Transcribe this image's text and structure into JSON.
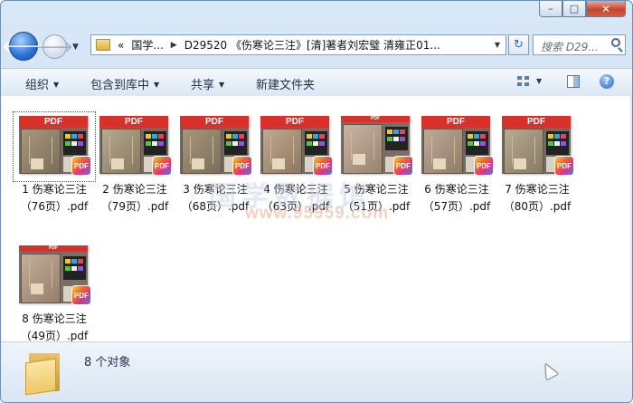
{
  "window": {
    "minimize_label": "–",
    "maximize_label": "□",
    "close_label": "✕"
  },
  "nav": {
    "back_label": "🡐",
    "forward_label": "🡒",
    "dropdown_label": "▼",
    "breadcrumb_overflow": "«",
    "breadcrumb_root": "国学...",
    "breadcrumb_sep": "▶",
    "breadcrumb_current": "D29520 《伤寒论三注》[清]著者刘宏璧 清雍正01...",
    "address_dropdown": "▼",
    "refresh_label": "↻",
    "search_placeholder": "搜索 D29..."
  },
  "toolbar": {
    "organize": "组织",
    "include_library": "包含到库中",
    "share": "共享",
    "new_folder": "新建文件夹",
    "help": "?"
  },
  "icons": {
    "back": "back-arrow-icon",
    "forward": "forward-arrow-icon",
    "search": "search-icon",
    "views": "views-icon",
    "preview": "preview-pane-icon",
    "help": "help-icon",
    "pdf": "pdf-icon",
    "folder": "folder-icon"
  },
  "files": [
    {
      "line1": "1 伤寒论三注",
      "line2": "（76页）.pdf",
      "banner": "PDF",
      "badge": "PDF"
    },
    {
      "line1": "2 伤寒论三注",
      "line2": "（79页）.pdf",
      "banner": "PDF",
      "badge": "PDF"
    },
    {
      "line1": "3 伤寒论三注",
      "line2": "（68页）.pdf",
      "banner": "PDF",
      "badge": "PDF"
    },
    {
      "line1": "4 伤寒论三注",
      "line2": "（63页）.pdf",
      "banner": "PDF",
      "badge": "PDF"
    },
    {
      "line1": "5 伤寒论三注",
      "line2": "（51页）.pdf",
      "banner": "PDF",
      "badge": "PDF"
    },
    {
      "line1": "6 伤寒论三注",
      "line2": "（57页）.pdf",
      "banner": "PDF",
      "badge": "PDF"
    },
    {
      "line1": "7 伤寒论三注",
      "line2": "（80页）.pdf",
      "banner": "PDF",
      "badge": "PDF"
    },
    {
      "line1": "8 伤寒论三注",
      "line2": "（49页）.pdf",
      "banner": "PDF",
      "badge": "PDF"
    }
  ],
  "watermark": {
    "text": "国学数据馆",
    "url": "www.95959.com"
  },
  "status": {
    "object_count": "8 个对象"
  }
}
